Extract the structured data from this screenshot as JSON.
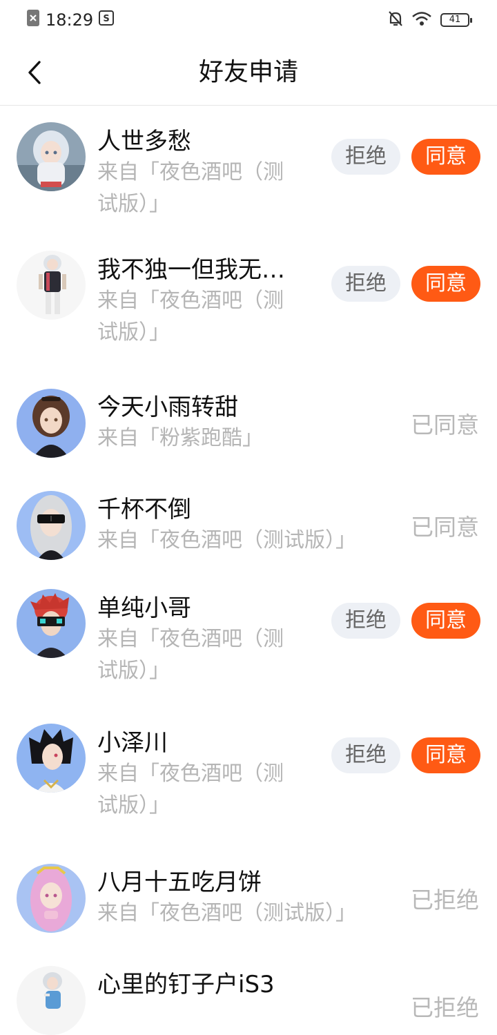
{
  "status_bar": {
    "time": "18:29",
    "battery": "41",
    "icons": [
      "sim-off-icon",
      "app-notification-icon",
      "bell-off-icon",
      "wifi-icon",
      "battery-icon"
    ]
  },
  "header": {
    "title": "好友申请",
    "back_icon": "back-chevron-icon"
  },
  "colors": {
    "accent": "#ff5a14",
    "reject_bg": "#edf0f5",
    "muted_text": "#b5b5b5"
  },
  "requests": [
    {
      "name": "人世多愁",
      "source_line1": "来自「夜色酒吧（测",
      "source_line2": "试版）」",
      "reject_label": "拒绝",
      "accept_label": "同意"
    },
    {
      "name": "我不独一但我无…",
      "source_line1": "来自「夜色酒吧（测",
      "source_line2": "试版）」",
      "reject_label": "拒绝",
      "accept_label": "同意"
    },
    {
      "name": "今天小雨转甜",
      "source_line1": "来自「粉紫跑酷」",
      "status": "已同意"
    },
    {
      "name": "千杯不倒",
      "source_line1": "来自「夜色酒吧（测试版）」",
      "status": "已同意"
    },
    {
      "name": "单纯小哥",
      "source_line1": "来自「夜色酒吧（测",
      "source_line2": "试版）」",
      "reject_label": "拒绝",
      "accept_label": "同意"
    },
    {
      "name": "小泽川",
      "source_line1": "来自「夜色酒吧（测",
      "source_line2": "试版）」",
      "reject_label": "拒绝",
      "accept_label": "同意"
    },
    {
      "name": "八月十五吃月饼",
      "source_line1": "来自「夜色酒吧（测试版）」",
      "status": "已拒绝"
    },
    {
      "name": "心里的钉子户iS3",
      "status": "已拒绝"
    }
  ]
}
